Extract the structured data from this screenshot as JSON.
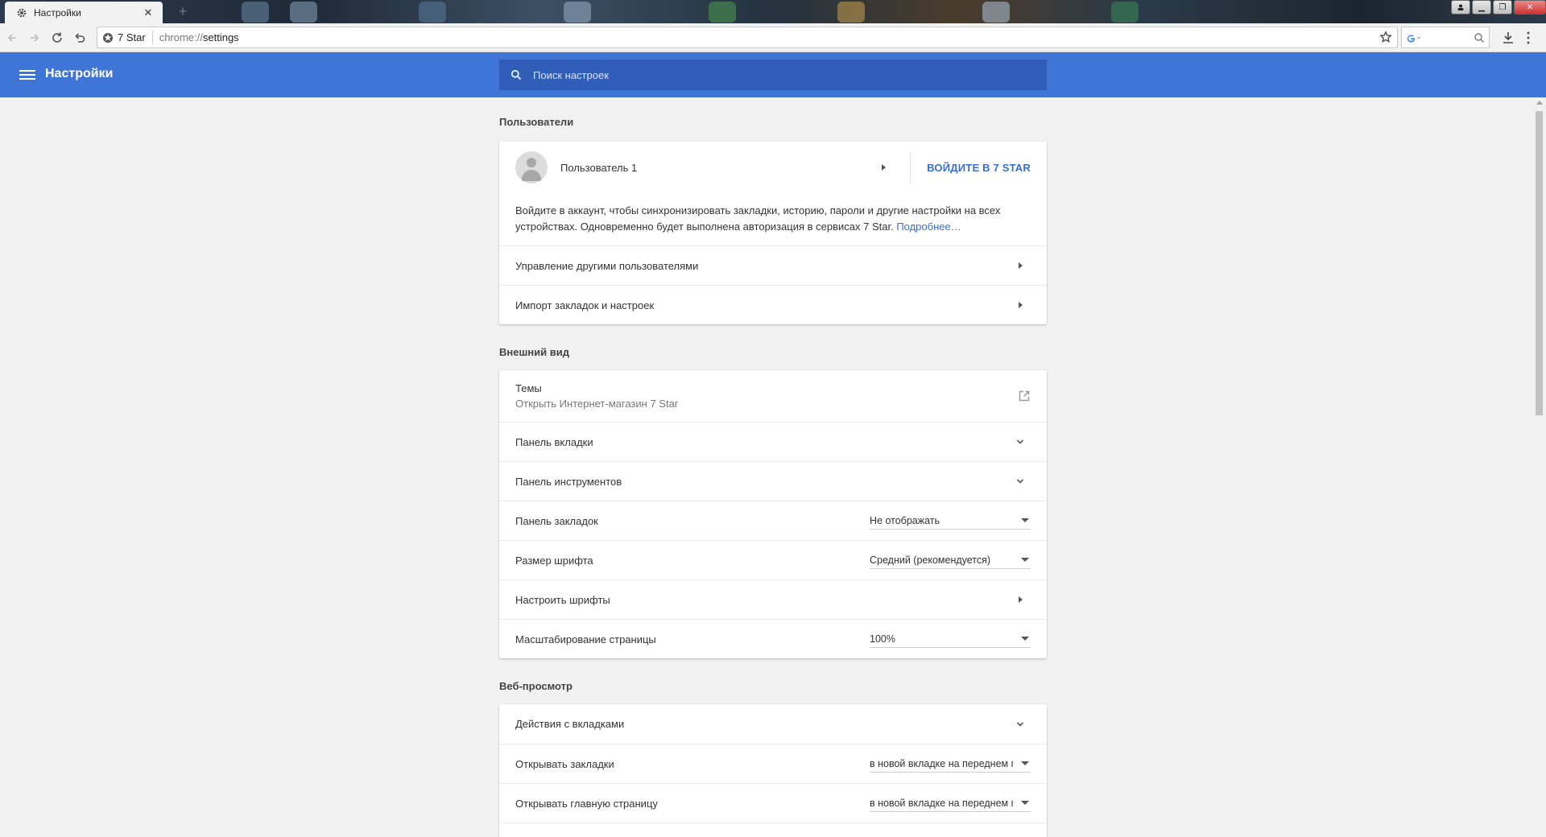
{
  "browser": {
    "tab": {
      "title": "Настройки",
      "icon": "gear-icon",
      "close": "✕"
    },
    "new_tab": "+",
    "window_controls": {
      "minimize": "▁",
      "restore": "❐",
      "close": "✕"
    },
    "omnibox": {
      "site": "7 Star",
      "url_scheme": "chrome://",
      "url_path": "settings"
    },
    "search_engine_icon": "google-g-icon"
  },
  "header": {
    "title": "Настройки",
    "search_placeholder": "Поиск настроек"
  },
  "sections": {
    "users": {
      "title": "Пользователи",
      "user_name": "Пользователь 1",
      "signin_button": "ВОЙДИТЕ В 7 STAR",
      "sync_text": "Войдите в аккаунт, чтобы синхронизировать закладки, историю, пароли и другие настройки на всех устройствах. Одновременно будет выполнена авторизация в сервисах 7 Star.",
      "sync_link": "Подробнее…",
      "manage_users": "Управление другими пользователями",
      "import": "Импорт закладок и настроек"
    },
    "appearance": {
      "title": "Внешний вид",
      "themes_title": "Темы",
      "themes_subtitle": "Открыть Интернет-магазин 7 Star",
      "tab_panel": "Панель вкладки",
      "tools_panel": "Панель инструментов",
      "bookmarks_bar": {
        "label": "Панель закладок",
        "value": "Не отображать"
      },
      "font_size": {
        "label": "Размер шрифта",
        "value": "Средний (рекомендуется)"
      },
      "customize_fonts": "Настроить шрифты",
      "page_zoom": {
        "label": "Масштабирование страницы",
        "value": "100%"
      }
    },
    "browsing": {
      "title": "Веб-просмотр",
      "tab_actions": "Действия с вкладками",
      "open_bookmarks": {
        "label": "Открывать закладки",
        "value": "в новой вкладке на переднем плане"
      },
      "open_homepage": {
        "label": "Открывать главную страницу",
        "value": "в новой вкладке на переднем плане"
      }
    }
  },
  "colors": {
    "header_bg": "#3f75d7",
    "search_bg": "#2f5db8",
    "link": "#3a6fd1",
    "page_bg": "#f1f1f1"
  }
}
